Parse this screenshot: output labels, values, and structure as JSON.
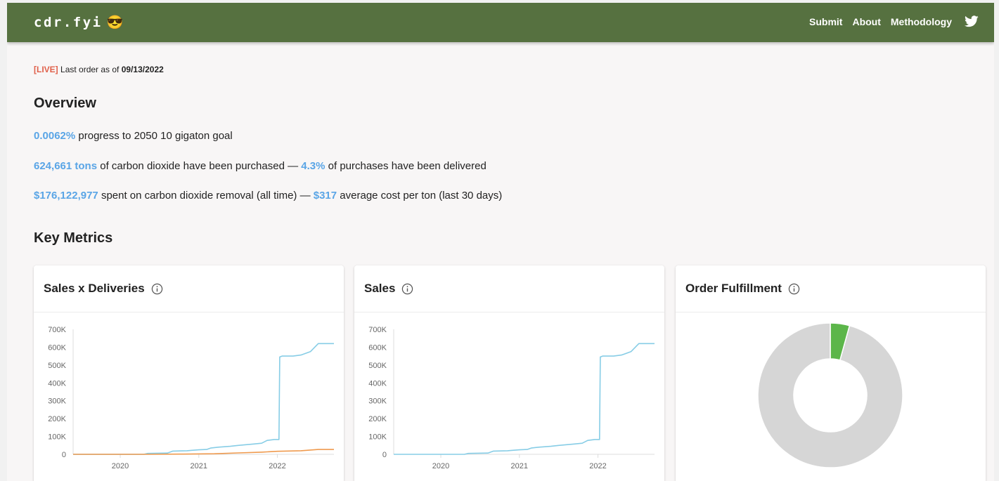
{
  "nav": {
    "brand": "cdr.fyi",
    "brand_emoji": "😎",
    "links": [
      "Submit",
      "About",
      "Methodology"
    ],
    "social_icon": "twitter-icon"
  },
  "status": {
    "live_tag": "[LIVE]",
    "text": "Last order as of",
    "date": "09/13/2022"
  },
  "overview": {
    "title": "Overview",
    "progress_value": "0.0062%",
    "progress_text": "progress to 2050 10 gigaton goal",
    "tons_value": "624,661 tons",
    "tons_text": "of carbon dioxide have been purchased —",
    "delivered_value": "4.3%",
    "delivered_text": "of purchases have been delivered",
    "spent_value": "$176,122,977",
    "spent_text": "spent on carbon dioxide removal (all time) —",
    "avg_value": "$317",
    "avg_text": "average cost per ton (last 30 days)"
  },
  "key_metrics": {
    "title": "Key Metrics",
    "cards": [
      {
        "title": "Sales x Deliveries"
      },
      {
        "title": "Sales"
      },
      {
        "title": "Order Fulfillment"
      }
    ]
  },
  "colors": {
    "nav": "#567140",
    "highlight": "#5aa5e6",
    "live": "#e0604a",
    "sales_line": "#87cde6",
    "deliveries_line": "#ef9a4e",
    "fulfilled": "#5cb64a",
    "unfulfilled": "#d6d6d6"
  },
  "chart_data": [
    {
      "type": "line",
      "title": "Sales x Deliveries",
      "ylim": [
        0,
        700000
      ],
      "y_ticks": [
        "0",
        "100K",
        "200K",
        "300K",
        "400K",
        "500K",
        "600K",
        "700K"
      ],
      "x_ticks": [
        "2020",
        "2021",
        "2022"
      ],
      "xlim": [
        2019.4,
        2022.72
      ],
      "series": [
        {
          "name": "Sales",
          "color": "#87cde6",
          "x": [
            2019.4,
            2019.9,
            2020.3,
            2020.35,
            2020.6,
            2020.67,
            2020.85,
            2020.9,
            2021.0,
            2021.1,
            2021.15,
            2021.25,
            2021.4,
            2021.5,
            2021.7,
            2021.8,
            2021.87,
            2021.96,
            2022.02,
            2022.03,
            2022.06,
            2022.2,
            2022.3,
            2022.42,
            2022.52,
            2022.72
          ],
          "y": [
            0,
            0,
            0,
            5000,
            7000,
            18000,
            20000,
            22000,
            25000,
            27000,
            35000,
            40000,
            45000,
            50000,
            58000,
            62000,
            78000,
            83000,
            83000,
            545000,
            550000,
            550000,
            556000,
            575000,
            620000,
            620000
          ]
        },
        {
          "name": "Deliveries",
          "color": "#ef9a4e",
          "x": [
            2019.4,
            2020.3,
            2020.8,
            2021.2,
            2021.5,
            2021.8,
            2022.0,
            2022.3,
            2022.52,
            2022.72
          ],
          "y": [
            0,
            0,
            1000,
            3000,
            8000,
            12000,
            17000,
            20000,
            27000,
            27000
          ]
        }
      ]
    },
    {
      "type": "line",
      "title": "Sales",
      "ylim": [
        0,
        700000
      ],
      "y_ticks": [
        "0",
        "100K",
        "200K",
        "300K",
        "400K",
        "500K",
        "600K",
        "700K"
      ],
      "x_ticks": [
        "2020",
        "2021",
        "2022"
      ],
      "xlim": [
        2019.4,
        2022.72
      ],
      "series": [
        {
          "name": "Sales",
          "color": "#87cde6",
          "x": [
            2019.4,
            2019.9,
            2020.3,
            2020.35,
            2020.6,
            2020.67,
            2020.85,
            2020.9,
            2021.0,
            2021.1,
            2021.15,
            2021.25,
            2021.4,
            2021.5,
            2021.7,
            2021.8,
            2021.87,
            2021.96,
            2022.02,
            2022.03,
            2022.06,
            2022.2,
            2022.3,
            2022.42,
            2022.52,
            2022.72
          ],
          "y": [
            0,
            0,
            0,
            5000,
            7000,
            18000,
            20000,
            22000,
            25000,
            27000,
            35000,
            40000,
            45000,
            50000,
            58000,
            62000,
            78000,
            83000,
            83000,
            545000,
            550000,
            550000,
            556000,
            575000,
            620000,
            620000
          ]
        }
      ]
    },
    {
      "type": "pie",
      "title": "Order Fulfillment",
      "donut": true,
      "slices": [
        {
          "color": "#5cb64a",
          "value": 4.3
        },
        {
          "color": "#d6d6d6",
          "value": 95.7
        }
      ]
    }
  ]
}
